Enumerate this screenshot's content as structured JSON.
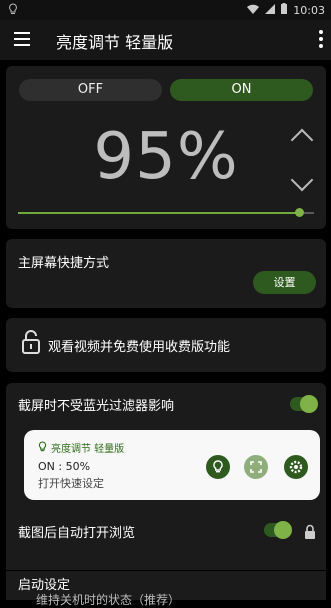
{
  "status_bar": {
    "time": "10:03"
  },
  "app_bar": {
    "title": "亮度调节 轻量版"
  },
  "brightness": {
    "off_label": "OFF",
    "on_label": "ON",
    "percent_text": "95%",
    "level": 0.95,
    "accent": "#2e5a1f",
    "slider_color": "#7fb347"
  },
  "shortcut": {
    "label": "主屏幕快捷方式",
    "button": "设置"
  },
  "unlock": {
    "label": "观看视频并免费使用收费版功能"
  },
  "filter": {
    "screenshot_label": "截屏时不受蓝光过滤器影响",
    "notification": {
      "app_name": "亮度调节 轻量版",
      "status": "ON : 50%",
      "hint": "打开快速设定"
    },
    "browse_label": "截图后自动打开浏览",
    "startup_label": "启动设定",
    "startup_sub": "维持关机时的状态（推荐）"
  }
}
